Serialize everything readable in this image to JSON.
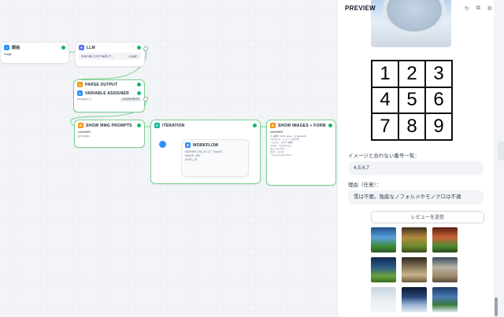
{
  "nodes": {
    "start": {
      "title": "開始",
      "input": "image"
    },
    "llm": {
      "title": "LLM",
      "model": "Gemini 2.0 Flash T...",
      "mode": "CHAT"
    },
    "parse": {
      "title": "PARSE OUTPUT"
    },
    "variable": {
      "title": "VARIABLE ASSIGNER",
      "var": "prompts_li...",
      "op": "OVERWRITE"
    },
    "show": {
      "title": "SHOW 9IMG PROMPTS",
      "field": "ANSWER",
      "value": "{{ #uvarp..."
    },
    "iteration": {
      "title": "ITERATION"
    },
    "workflow": {
      "title": "WORKFLOW",
      "line1": "WORKFLOW_ID: [\"{\" \"inputs\"...",
      "line2": "IMAGE_IDX",
      "line3": "SEED_ID"
    },
    "form": {
      "title": "SHOW IMAGES + FORM",
      "field": "ANSWER",
      "lines": [
        "※ 画像と1dify-inpgs... にSeededit... ",
        "mark.png ...ショートを行行... ",
        "...(入力) ...ボタン操作...",
        "image ...| inlines(上)...",
        "{{#...}} 以下の...",
        "表示 ...(入力)...",
        "...user.answer inline..."
      ]
    }
  },
  "panel": {
    "title": "PREVIEW",
    "grid_numbers": [
      "1",
      "2",
      "3",
      "4",
      "5",
      "6",
      "7",
      "8",
      "9"
    ],
    "label_numbers": "イメージと合わない番号一覧：",
    "value_numbers": "4,5,6,7",
    "label_reason": "理由（任意）：",
    "value_reason": "雪は不要。独座なノフォルメやモノクロは不適",
    "button": "レビューを送信",
    "colors": {
      "accent": "#2e90fa",
      "success": "#12b76a",
      "edge": "#7bd08f"
    }
  }
}
